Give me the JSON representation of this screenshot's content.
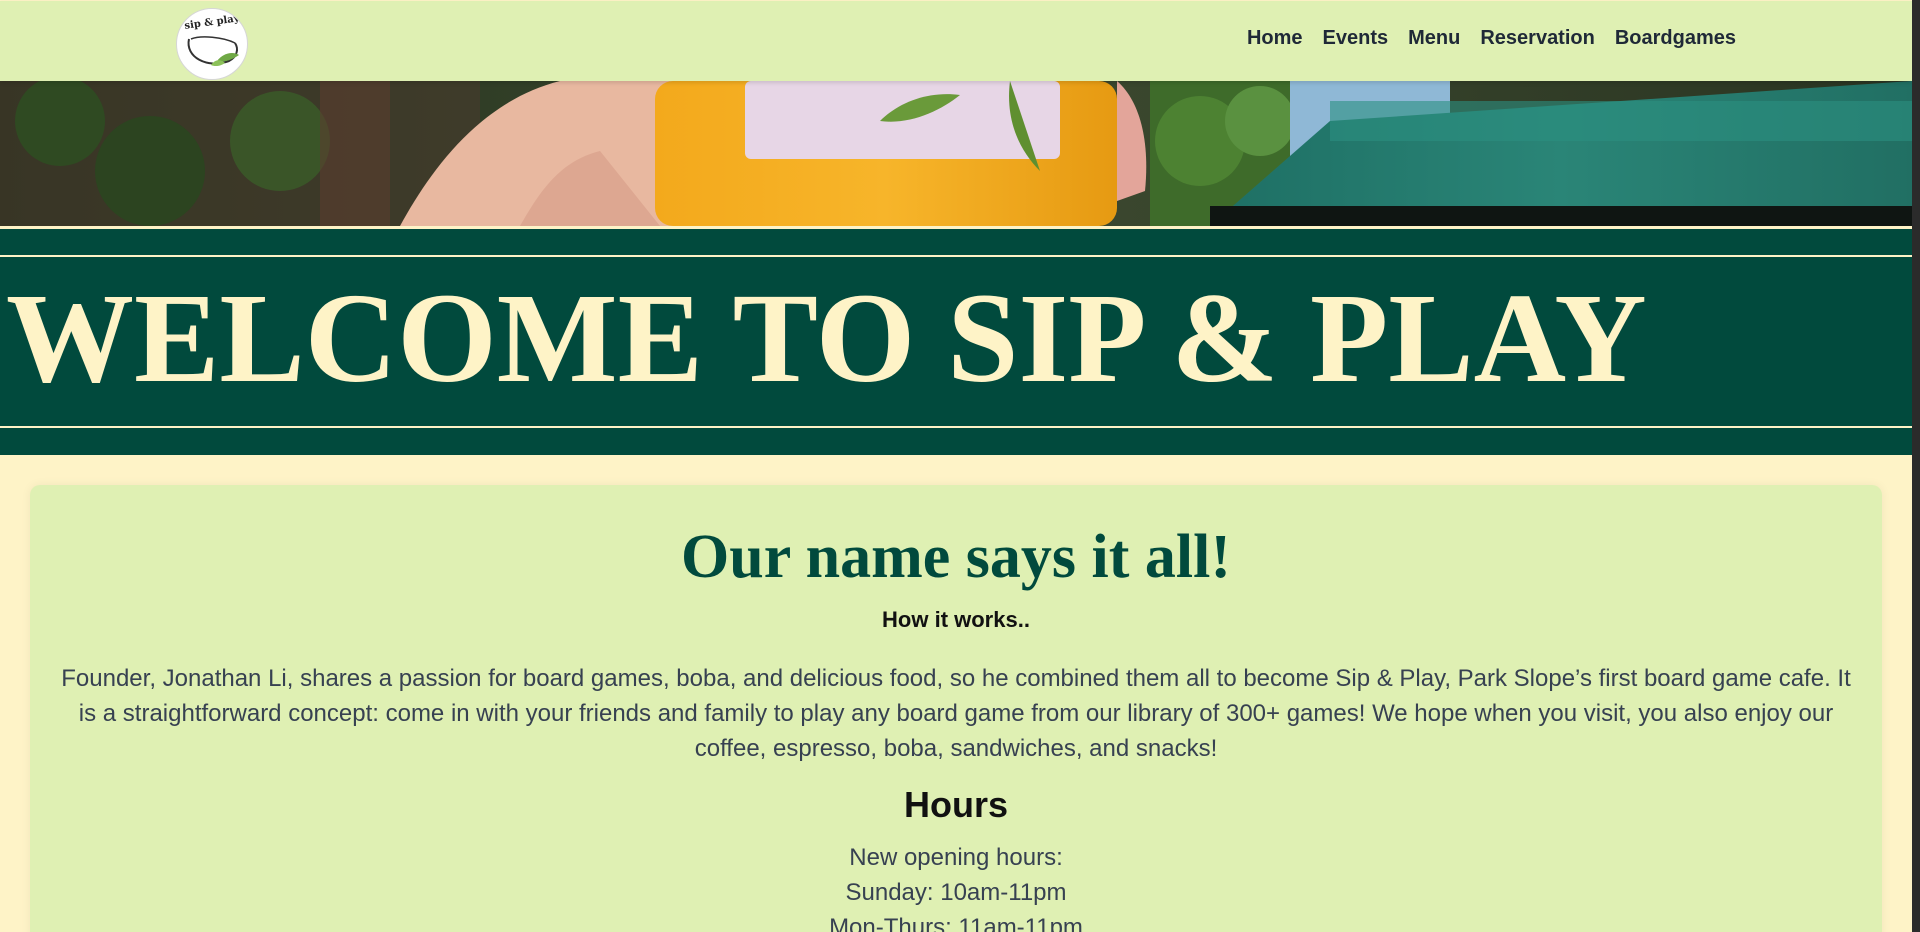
{
  "nav": {
    "logo_text": "sip & play",
    "links": [
      "Home",
      "Events",
      "Menu",
      "Reservation",
      "Boardgames"
    ]
  },
  "banner": {
    "title": "WELCOME TO SIP & PLAY"
  },
  "about": {
    "title": "Our name says it all!",
    "subtitle": "How it works..",
    "body": "Founder, Jonathan Li, shares a passion for board games, boba, and delicious food, so he combined them all to become Sip & Play, Park Slope’s first board game cafe. It is a straightforward concept: come in with your friends and family to play any board game from our library of 300+ games! We hope when you visit, you also enjoy our coffee, espresso, boba, sandwiches, and snacks!"
  },
  "hours": {
    "heading": "Hours",
    "lines": [
      "New opening hours:",
      "Sunday: 10am-11pm",
      "Mon-Thurs: 11am-11pm"
    ]
  },
  "colors": {
    "nav_background": "#dff0b3",
    "page_background": "#fef3c7",
    "banner_green": "#014a3d",
    "banner_text": "#fef3c7",
    "card_title": "#014a3d"
  },
  "icons": {
    "logo": "sip-and-play-logo-icon"
  }
}
